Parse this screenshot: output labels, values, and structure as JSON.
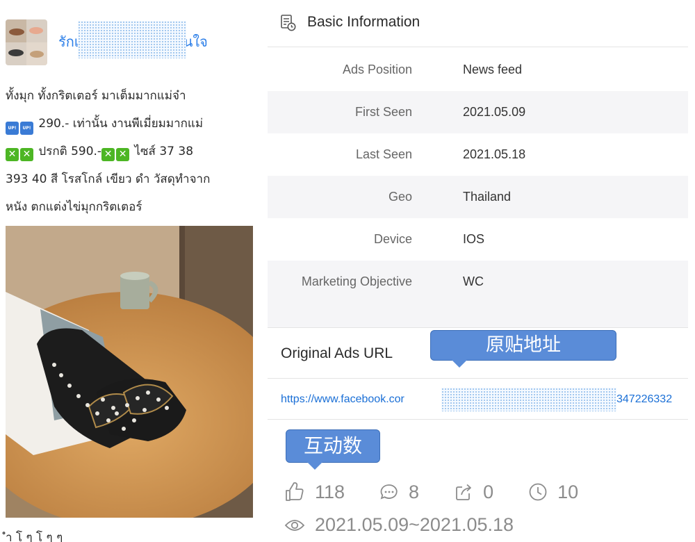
{
  "post": {
    "page_name_start": "รักเ",
    "page_name_end": "นใจ",
    "text_lines": [
      "ทั้งมุก ทั้งกริตเตอร์ มาเต็มมากแม่จ๋า",
      "290.- เท่านั้น งานพีเมี่ยมมากแม่",
      "ปรกติ 590.-",
      "ไซส์ 37 38",
      "393 40 สี โรสโกล์ เขียว ดำ วัสดุทำจาก",
      "หนัง ตกแต่งไข่มุกกริตเตอร์"
    ],
    "emoji_up_label": "UP!",
    "emoji_x_label": "✕",
    "bottom_text": "ำ โ ๆ โ ๆ ๆ"
  },
  "info": {
    "section_title": "Basic Information",
    "section_icon": "document-clock-icon",
    "rows": [
      {
        "label": "Ads Position",
        "value": "News feed"
      },
      {
        "label": "First Seen",
        "value": "2021.05.09"
      },
      {
        "label": "Last Seen",
        "value": "2021.05.18"
      },
      {
        "label": "Geo",
        "value": "Thailand"
      },
      {
        "label": "Device",
        "value": "IOS"
      },
      {
        "label": "Marketing Objective",
        "value": "WC"
      }
    ]
  },
  "url_section": {
    "label": "Original Ads URL",
    "callout": "原贴地址",
    "link_start": "https://www.facebook.cor",
    "link_end": "347226332"
  },
  "engagement": {
    "callout": "互动数",
    "likes": "118",
    "comments": "8",
    "shares": "0",
    "days": "10",
    "date_range": "2021.05.09~2021.05.18"
  },
  "colors": {
    "link": "#1a6fd6",
    "callout": "#5a8cd8",
    "row_shade": "#f5f5f7",
    "stat_grey": "#8c8c8c"
  }
}
